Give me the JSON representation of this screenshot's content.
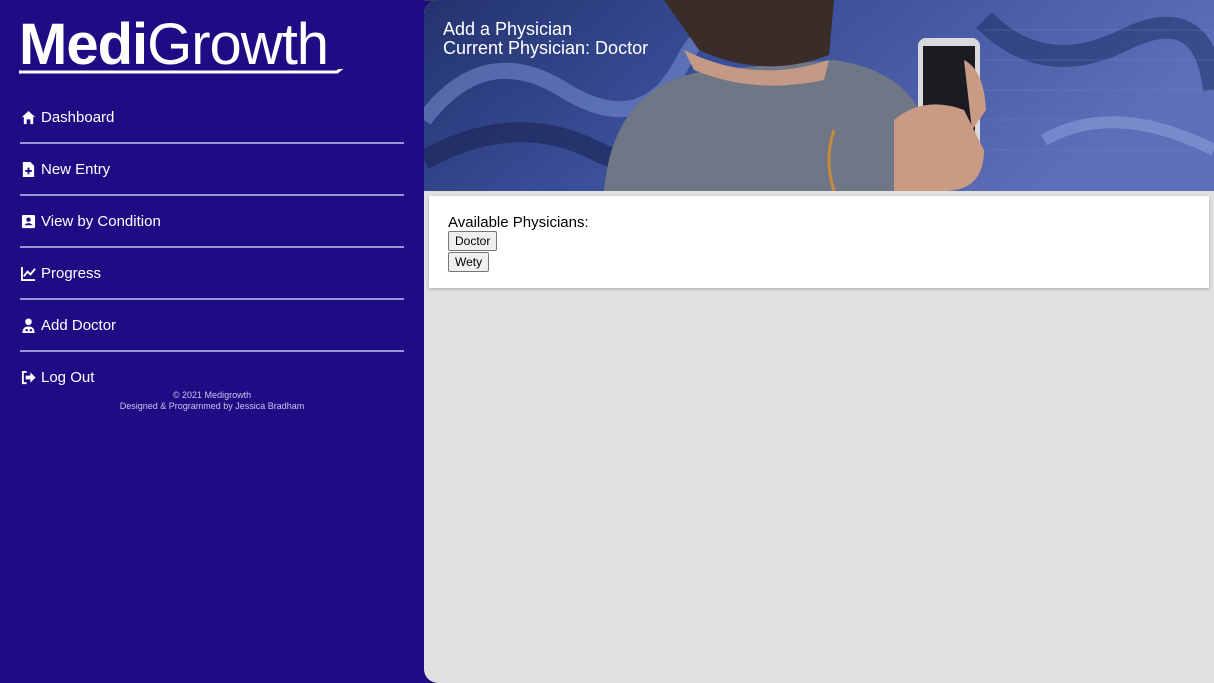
{
  "sidebar": {
    "logo": {
      "bold": "Medi",
      "regular": "Growth"
    },
    "nav": [
      {
        "label": "Dashboard",
        "icon": "home-icon"
      },
      {
        "label": "New Entry",
        "icon": "file-plus-icon"
      },
      {
        "label": "View by Condition",
        "icon": "book-icon"
      },
      {
        "label": "Progress",
        "icon": "chart-line-icon"
      },
      {
        "label": "Add Doctor",
        "icon": "user-doctor-icon"
      },
      {
        "label": "Log Out",
        "icon": "sign-out-icon"
      }
    ],
    "footer": {
      "copyright": "© 2021 Medigrowth",
      "credit": "Designed & Programmed by Jessica Bradham"
    }
  },
  "header": {
    "title": "Add a Physician",
    "current": "Current Physician: Doctor"
  },
  "physicians": {
    "label": "Available Physicians:",
    "items": [
      "Doctor",
      "Wety"
    ]
  },
  "colors": {
    "sidebar_bg": "#1e0c85",
    "content_bg": "#e0e0e0",
    "divider": "#9a93d8"
  }
}
